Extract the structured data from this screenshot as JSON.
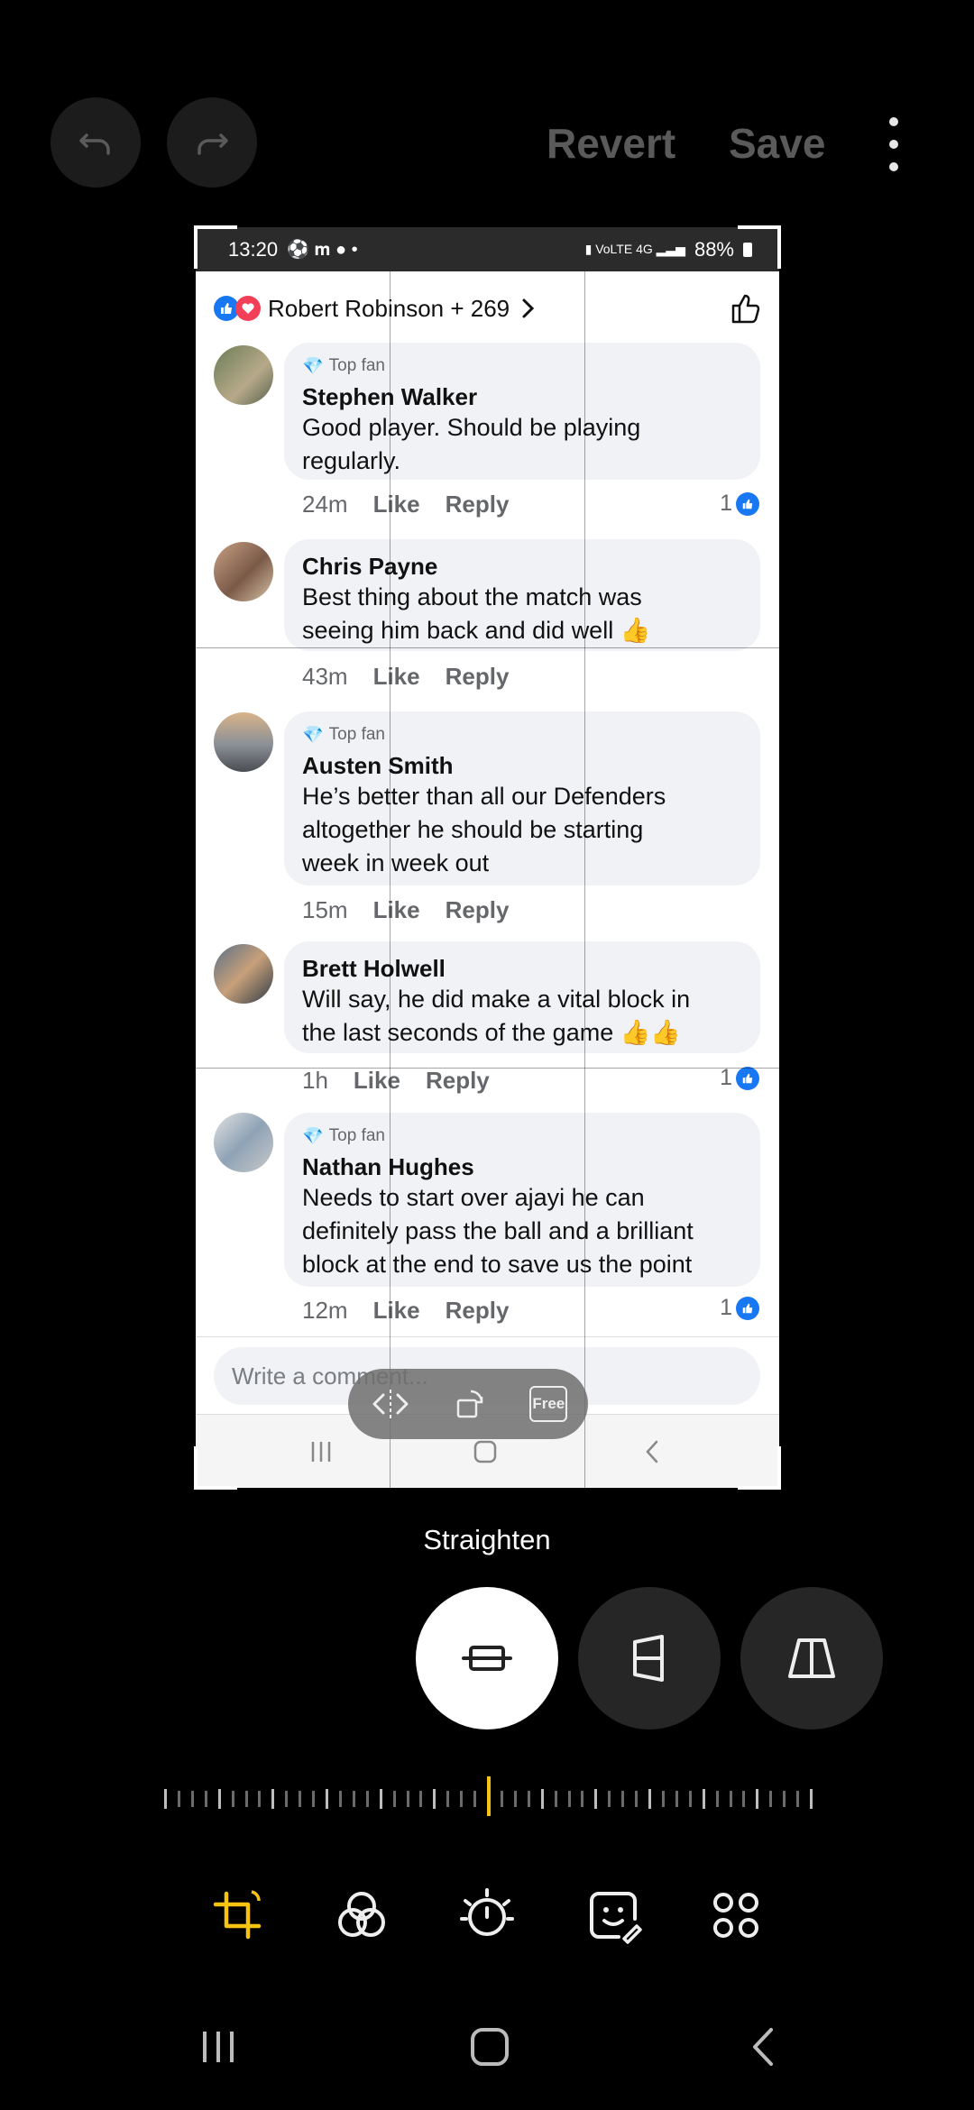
{
  "editor": {
    "revert_label": "Revert",
    "save_label": "Save",
    "straighten_label": "Straighten",
    "accent_color": "#f7c312"
  },
  "screenshot": {
    "status_bar": {
      "time": "13:20",
      "battery": "88%"
    },
    "reactions": {
      "text": "Robert Robinson + 269"
    },
    "comments": [
      {
        "top_fan": "Top fan",
        "name": "Stephen Walker",
        "lines": [
          "Good player. Should be playing",
          "regularly."
        ],
        "time": "24m",
        "like": "Like",
        "reply": "Reply",
        "likes": "1"
      },
      {
        "top_fan": "",
        "name": "Chris Payne",
        "lines": [
          "Best thing about the match was",
          "seeing him back and did well 👍"
        ],
        "time": "43m",
        "like": "Like",
        "reply": "Reply",
        "likes": ""
      },
      {
        "top_fan": "Top fan",
        "name": "Austen Smith",
        "lines": [
          "He’s better than all our Defenders",
          "altogether he should be starting",
          "week in week out"
        ],
        "time": "15m",
        "like": "Like",
        "reply": "Reply",
        "likes": ""
      },
      {
        "top_fan": "",
        "name": "Brett Holwell",
        "lines": [
          "Will say, he did make a vital block in",
          "the last seconds of the game 👍👍"
        ],
        "time": "1h",
        "like": "Like",
        "reply": "Reply",
        "likes": "1"
      },
      {
        "top_fan": "Top fan",
        "name": "Nathan Hughes",
        "lines": [
          "Needs to start over ajayi he can",
          "definitely pass the ball and a brilliant",
          "block at the end to save us the point"
        ],
        "time": "12m",
        "like": "Like",
        "reply": "Reply",
        "likes": "1"
      }
    ],
    "write_placeholder": "Write a comment...",
    "free_label": "Free"
  }
}
